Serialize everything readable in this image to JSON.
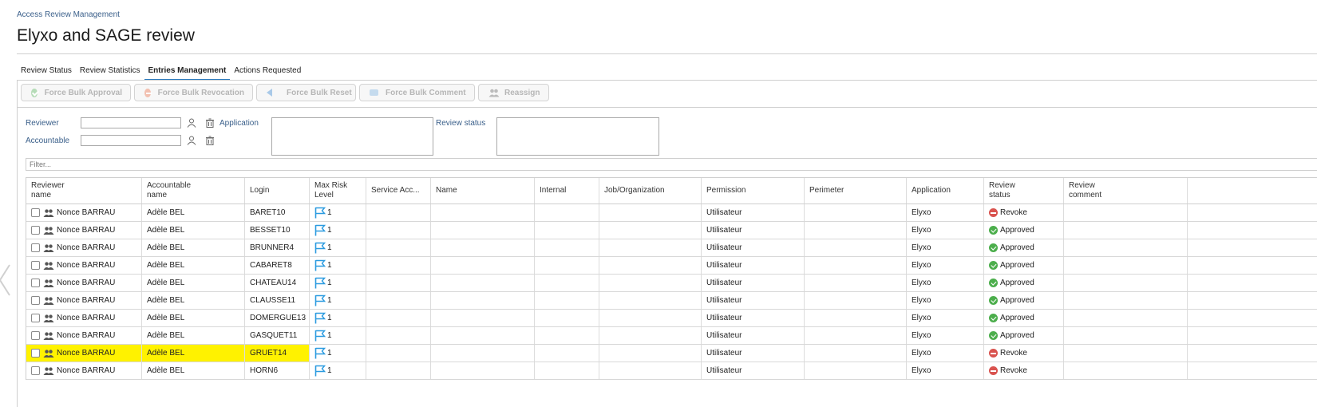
{
  "breadcrumb": "Access Review Management",
  "title": "Elyxo and SAGE review",
  "tabs": [
    {
      "label": "Review Status",
      "active": false
    },
    {
      "label": "Review Statistics",
      "active": false
    },
    {
      "label": "Entries Management",
      "active": true
    },
    {
      "label": "Actions Requested",
      "active": false
    }
  ],
  "toolbar": {
    "force_bulk_approval": "Force Bulk Approval",
    "force_bulk_revocation": "Force Bulk Revocation",
    "force_bulk_reset": "Force Bulk Reset",
    "force_bulk_comment": "Force Bulk Comment",
    "reassign": "Reassign"
  },
  "filters": {
    "reviewer_label": "Reviewer",
    "reviewer_value": "",
    "accountable_label": "Accountable",
    "accountable_value": "",
    "application_label": "Application",
    "review_status_label": "Review status",
    "filter_placeholder": "Filter..."
  },
  "columns": {
    "reviewer_name": "Reviewer\nname",
    "accountable_name": "Accountable\nname",
    "login": "Login",
    "max_risk_level": "Max Risk\nLevel",
    "service_account": "Service Acc...",
    "name": "Name",
    "internal": "Internal",
    "job_organization": "Job/Organization",
    "permission": "Permission",
    "perimeter": "Perimeter",
    "application": "Application",
    "review_status": "Review\nstatus",
    "review_comment": "Review\ncomment"
  },
  "rows": [
    {
      "reviewer": "Nonce BARRAU",
      "accountable": "Adèle BEL",
      "login": "BARET10",
      "risk": "1",
      "permission": "Utilisateur",
      "application": "Elyxo",
      "status": "Revoke",
      "highlighted": false
    },
    {
      "reviewer": "Nonce BARRAU",
      "accountable": "Adèle BEL",
      "login": "BESSET10",
      "risk": "1",
      "permission": "Utilisateur",
      "application": "Elyxo",
      "status": "Approved",
      "highlighted": false
    },
    {
      "reviewer": "Nonce BARRAU",
      "accountable": "Adèle BEL",
      "login": "BRUNNER4",
      "risk": "1",
      "permission": "Utilisateur",
      "application": "Elyxo",
      "status": "Approved",
      "highlighted": false
    },
    {
      "reviewer": "Nonce BARRAU",
      "accountable": "Adèle BEL",
      "login": "CABARET8",
      "risk": "1",
      "permission": "Utilisateur",
      "application": "Elyxo",
      "status": "Approved",
      "highlighted": false
    },
    {
      "reviewer": "Nonce BARRAU",
      "accountable": "Adèle BEL",
      "login": "CHATEAU14",
      "risk": "1",
      "permission": "Utilisateur",
      "application": "Elyxo",
      "status": "Approved",
      "highlighted": false
    },
    {
      "reviewer": "Nonce BARRAU",
      "accountable": "Adèle BEL",
      "login": "CLAUSSE11",
      "risk": "1",
      "permission": "Utilisateur",
      "application": "Elyxo",
      "status": "Approved",
      "highlighted": false
    },
    {
      "reviewer": "Nonce BARRAU",
      "accountable": "Adèle BEL",
      "login": "DOMERGUE13",
      "risk": "1",
      "permission": "Utilisateur",
      "application": "Elyxo",
      "status": "Approved",
      "highlighted": false
    },
    {
      "reviewer": "Nonce BARRAU",
      "accountable": "Adèle BEL",
      "login": "GASQUET11",
      "risk": "1",
      "permission": "Utilisateur",
      "application": "Elyxo",
      "status": "Approved",
      "highlighted": false
    },
    {
      "reviewer": "Nonce BARRAU",
      "accountable": "Adèle BEL",
      "login": "GRUET14",
      "risk": "1",
      "permission": "Utilisateur",
      "application": "Elyxo",
      "status": "Revoke",
      "highlighted": true
    },
    {
      "reviewer": "Nonce BARRAU",
      "accountable": "Adèle BEL",
      "login": "HORN6",
      "risk": "1",
      "permission": "Utilisateur",
      "application": "Elyxo",
      "status": "Revoke",
      "highlighted": false
    }
  ],
  "colors": {
    "accent": "#2b7bbf",
    "label": "#3a5f8a",
    "highlight": "#fff200",
    "revoke": "#d9534f",
    "approved": "#4cae4c",
    "flag": "#2b9be0"
  }
}
